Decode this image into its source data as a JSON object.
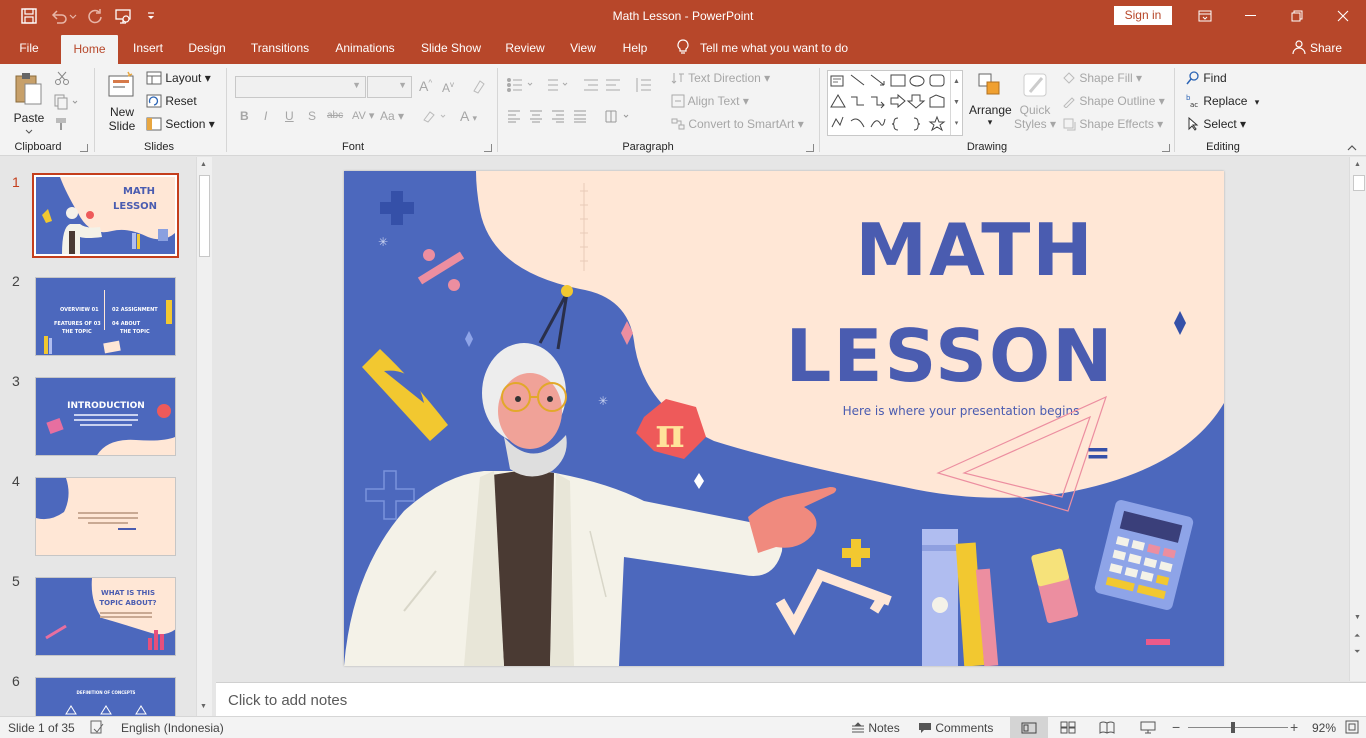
{
  "titlebar": {
    "title": "Math Lesson  -  PowerPoint",
    "sign_in": "Sign in"
  },
  "tabs": [
    "File",
    "Home",
    "Insert",
    "Design",
    "Transitions",
    "Animations",
    "Slide Show",
    "Review",
    "View",
    "Help"
  ],
  "active_tab": "Home",
  "tell_me": "Tell me what you want to do",
  "share": "Share",
  "ribbon": {
    "clipboard": {
      "label": "Clipboard",
      "paste": "Paste"
    },
    "slides": {
      "label": "Slides",
      "new_slide_1": "New",
      "new_slide_2": "Slide",
      "layout": "Layout",
      "reset": "Reset",
      "section": "Section"
    },
    "font": {
      "label": "Font",
      "bold": "B",
      "italic": "I",
      "underline": "U",
      "shadow": "S",
      "strike": "abc",
      "spacing": "AV",
      "case": "Aa",
      "color": "A"
    },
    "paragraph": {
      "label": "Paragraph",
      "text_direction": "Text Direction",
      "align_text": "Align Text",
      "convert_smartart": "Convert to SmartArt"
    },
    "drawing": {
      "label": "Drawing",
      "arrange": "Arrange",
      "quick_styles_1": "Quick",
      "quick_styles_2": "Styles",
      "shape_fill": "Shape Fill",
      "shape_outline": "Shape Outline",
      "shape_effects": "Shape Effects"
    },
    "editing": {
      "label": "Editing",
      "find": "Find",
      "replace": "Replace",
      "select": "Select"
    }
  },
  "thumbnails": [
    {
      "num": "1",
      "title1": "MATH",
      "title2": "LESSON"
    },
    {
      "num": "2",
      "c1": "OVERVIEW  01",
      "c2": "02  ASSIGNMENT",
      "c3": "FEATURES OF  03",
      "c3b": "THE TOPIC",
      "c4": "04  ABOUT",
      "c4b": "THE TOPIC"
    },
    {
      "num": "3",
      "title": "INTRODUCTION"
    },
    {
      "num": "4"
    },
    {
      "num": "5",
      "title1": "WHAT IS THIS",
      "title2": "TOPIC ABOUT?"
    },
    {
      "num": "6",
      "title": "DEFINITION OF CONCEPTS"
    }
  ],
  "slide": {
    "title1": "MATH",
    "title2": "LESSON",
    "subtitle": "Here is where your presentation begins",
    "pi": "π",
    "equals": "="
  },
  "notes_placeholder": "Click to add notes",
  "status": {
    "slide_count": "Slide 1 of 35",
    "language": "English (Indonesia)",
    "notes": "Notes",
    "comments": "Comments",
    "zoom": "92%"
  },
  "colors": {
    "accent": "#b7472a",
    "slide_blue": "#4c68bd",
    "slide_cream": "#ffe7d6",
    "title_blue": "#4a5cb0"
  }
}
